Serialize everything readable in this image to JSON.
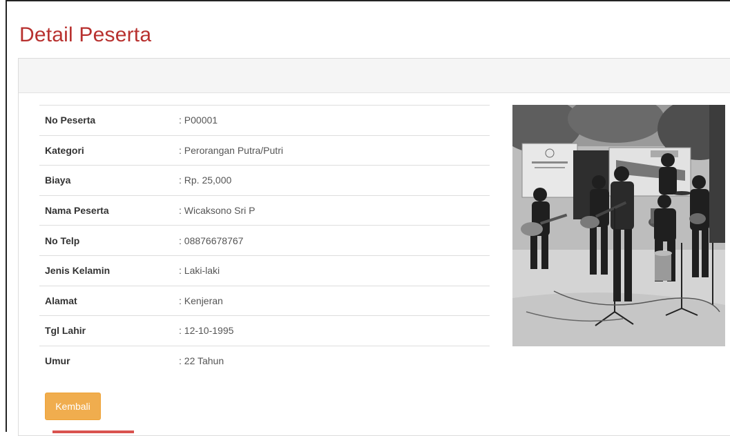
{
  "page": {
    "title": "Detail Peserta"
  },
  "details": [
    {
      "label": "No Peserta",
      "value": ": P00001"
    },
    {
      "label": "Kategori",
      "value": ": Perorangan Putra/Putri"
    },
    {
      "label": "Biaya",
      "value": ": Rp. 25,000"
    },
    {
      "label": "Nama Peserta",
      "value": ": Wicaksono Sri P"
    },
    {
      "label": "No Telp",
      "value": ": 08876678767"
    },
    {
      "label": "Jenis Kelamin",
      "value": ": Laki-laki"
    },
    {
      "label": "Alamat",
      "value": ": Kenjeran"
    },
    {
      "label": "Tgl Lahir",
      "value": ": 12-10-1995"
    },
    {
      "label": "Umur",
      "value": ": 22 Tahun"
    }
  ],
  "actions": {
    "back_label": "Kembali"
  },
  "colors": {
    "title": "#b8312f",
    "back_button": "#f0ad4e",
    "accent": "#d9534f"
  },
  "photo": {
    "icon": "participant-photo"
  }
}
